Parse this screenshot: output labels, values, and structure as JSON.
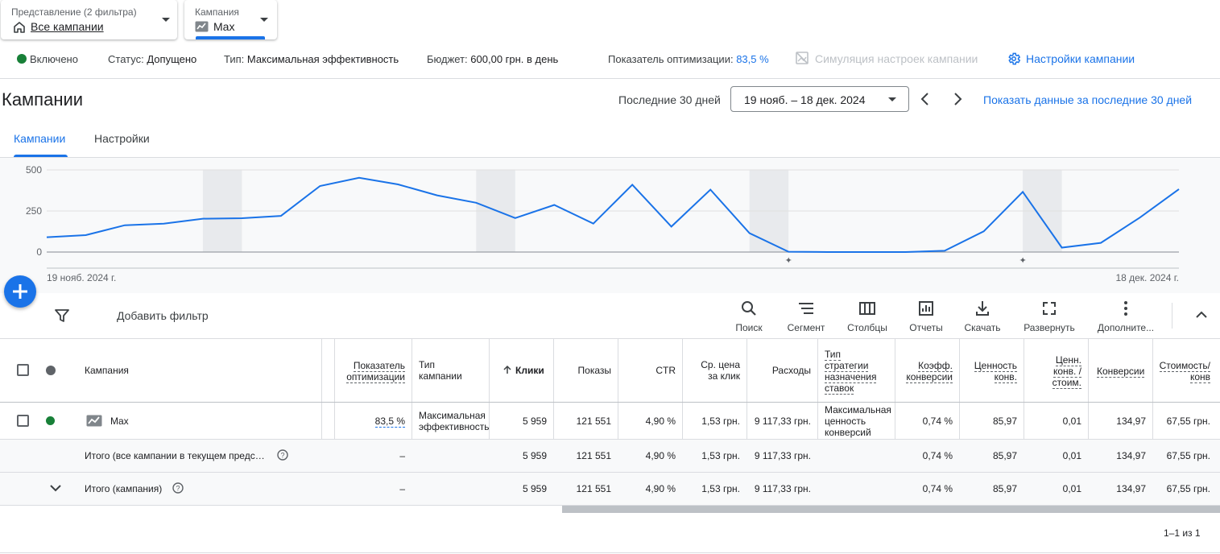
{
  "filters": {
    "view": {
      "label": "Представление (2 фильтра)",
      "value": "Все кампании"
    },
    "campaign": {
      "label": "Кампания",
      "value": "Max"
    }
  },
  "status_bar": {
    "enabled": "Включено",
    "status_label": "Статус:",
    "status_value": "Допущено",
    "type_label": "Тип:",
    "type_value": "Максимальная эффективность",
    "budget_label": "Бюджет:",
    "budget_value": "600,00 грн. в день",
    "opt_label": "Показатель оптимизации:",
    "opt_value": "83,5 %",
    "simulation": "Симуляция настроек кампании",
    "settings": "Настройки кампании"
  },
  "header": {
    "title": "Кампании",
    "range_label": "Последние 30 дней",
    "range_value": "19 нояб. – 18 дек. 2024",
    "show_last": "Показать данные за последние 30 дней"
  },
  "tabs": [
    "Кампании",
    "Настройки"
  ],
  "chart_data": {
    "type": "line",
    "y_ticks": [
      "500",
      "250",
      "0"
    ],
    "ylim": [
      0,
      500
    ],
    "x_start_label": "19 нояб. 2024 г.",
    "x_end_label": "18 дек. 2024 г.",
    "values": [
      90,
      103,
      163,
      173,
      203,
      206,
      220,
      402,
      452,
      412,
      345,
      300,
      207,
      287,
      173,
      410,
      155,
      380,
      115,
      2,
      0,
      0,
      0,
      8,
      126,
      366,
      27,
      56,
      210,
      383
    ],
    "grid": true,
    "colors": {
      "line": "#1a73e8",
      "weekend": "#e8eaed"
    }
  },
  "toolbar": {
    "add_filter": "Добавить фильтр",
    "search": "Поиск",
    "segment": "Сегмент",
    "columns": "Столбцы",
    "reports": "Отчеты",
    "download": "Скачать",
    "expand": "Развернуть",
    "more": "Дополните..."
  },
  "table": {
    "headers": {
      "campaign": "Кампания",
      "opt1": "Показатель",
      "opt2": "оптимизации",
      "type1": "Тип",
      "type2": "кампании",
      "clicks": "Клики",
      "impr": "Показы",
      "ctr": "CTR",
      "cpc1": "Ср. цена",
      "cpc2": "за клик",
      "cost": "Расходы",
      "bid1": "Тип",
      "bid2": "стратегии",
      "bid3": "назначения",
      "bid4": "ставок",
      "cr1": "Коэфф.",
      "cr2": "конверсии",
      "val1": "Ценность",
      "val2": "конв.",
      "vc1": "Ценн.",
      "vc2": "конв. /",
      "vc3": "стоим.",
      "conv": "Конверсии",
      "cpa1": "Стоимость/",
      "cpa2": "конв"
    },
    "row": {
      "name": "Max",
      "opt": "83,5 %",
      "type1": "Максимальная",
      "type2": "эффективность",
      "clicks": "5 959",
      "impr": "121 551",
      "ctr": "4,90 %",
      "cpc": "1,53 грн.",
      "cost": "9 117,33 грн.",
      "bid1": "Максимальная",
      "bid2": "ценность",
      "bid3": "конверсий",
      "cr": "0,74 %",
      "val": "85,97",
      "vc": "0,01",
      "conv": "134,97",
      "cpa": "67,55 грн."
    },
    "total_all": {
      "label": "Итого (все кампании в текущем предс…",
      "opt": "–",
      "clicks": "5 959",
      "impr": "121 551",
      "ctr": "4,90 %",
      "cpc": "1,53 грн.",
      "cost": "9 117,33 грн.",
      "cr": "0,74 %",
      "val": "85,97",
      "vc": "0,01",
      "conv": "134,97",
      "cpa": "67,55 грн."
    },
    "total_campaign": {
      "label": "Итого (кампания)",
      "opt": "–",
      "clicks": "5 959",
      "impr": "121 551",
      "ctr": "4,90 %",
      "cpc": "1,53 грн.",
      "cost": "9 117,33 грн.",
      "cr": "0,74 %",
      "val": "85,97",
      "vc": "0,01",
      "conv": "134,97",
      "cpa": "67,55 грн."
    }
  },
  "pagination": "1–1 из 1"
}
